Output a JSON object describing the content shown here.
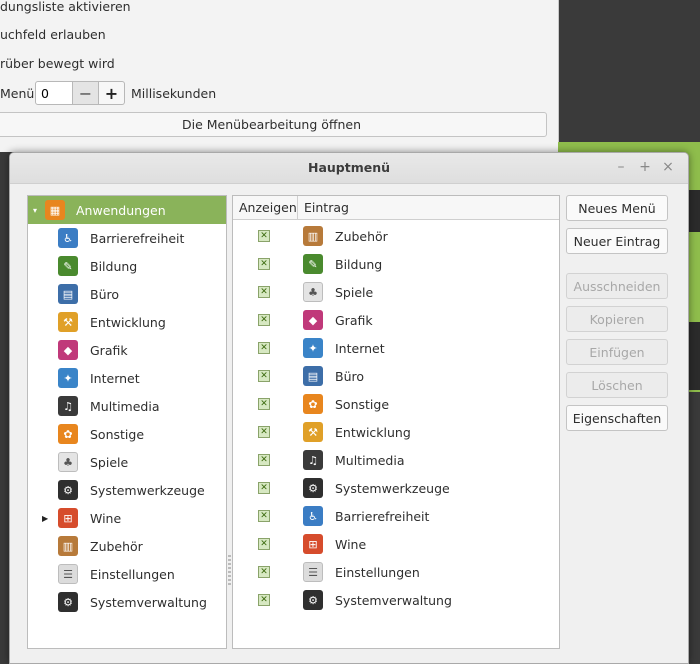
{
  "background_window": {
    "lines": [
      "dungsliste aktivieren",
      "uchfeld erlauben",
      "rüber bewegt wird"
    ],
    "delay_label": "Menü:",
    "delay_value": "0",
    "delay_unit": "Millisekunden",
    "minus": "−",
    "plus": "+",
    "open_editor": "Die Menübearbeitung öffnen"
  },
  "dialog": {
    "title": "Hauptmenü",
    "wm_minimize": "–",
    "wm_maximize": "+",
    "wm_close": "×"
  },
  "tree": {
    "root": {
      "label": "Anwendungen",
      "icon": "applications-icon",
      "expanded": true,
      "selected": true
    },
    "items": [
      {
        "label": "Barrierefreiheit",
        "icon": "accessibility-icon",
        "color": "#3b7dc4"
      },
      {
        "label": "Bildung",
        "icon": "education-icon",
        "color": "#4a8a2e"
      },
      {
        "label": "Büro",
        "icon": "office-icon",
        "color": "#3d6ea8"
      },
      {
        "label": "Entwicklung",
        "icon": "development-icon",
        "color": "#e0a028"
      },
      {
        "label": "Grafik",
        "icon": "graphics-icon",
        "color": "#c0397a"
      },
      {
        "label": "Internet",
        "icon": "internet-icon",
        "color": "#3a84c8"
      },
      {
        "label": "Multimedia",
        "icon": "multimedia-icon",
        "color": "#3a3a3a"
      },
      {
        "label": "Sonstige",
        "icon": "other-icon",
        "color": "#e8861e"
      },
      {
        "label": "Spiele",
        "icon": "games-icon",
        "color": "#e4e4e4"
      },
      {
        "label": "Systemwerkzeuge",
        "icon": "system-tools-icon",
        "color": "#2f2f2f"
      },
      {
        "label": "Wine",
        "icon": "wine-icon",
        "color": "#d64c2c",
        "collapsed_arrow": true
      },
      {
        "label": "Zubehör",
        "icon": "accessories-icon",
        "color": "#b77a3a"
      },
      {
        "label": "Einstellungen",
        "icon": "settings-icon",
        "color": "#dcdcdc"
      },
      {
        "label": "Systemverwaltung",
        "icon": "administration-icon",
        "color": "#2f2f2f"
      }
    ]
  },
  "list": {
    "col_show": "Anzeigen",
    "col_entry": "Eintrag",
    "rows": [
      {
        "label": "Zubehör",
        "icon": "accessories-icon",
        "color": "#b77a3a"
      },
      {
        "label": "Bildung",
        "icon": "education-icon",
        "color": "#4a8a2e"
      },
      {
        "label": "Spiele",
        "icon": "games-icon",
        "color": "#e4e4e4"
      },
      {
        "label": "Grafik",
        "icon": "graphics-icon",
        "color": "#c0397a"
      },
      {
        "label": "Internet",
        "icon": "internet-icon",
        "color": "#3a84c8"
      },
      {
        "label": "Büro",
        "icon": "office-icon",
        "color": "#3d6ea8"
      },
      {
        "label": "Sonstige",
        "icon": "other-icon",
        "color": "#e8861e"
      },
      {
        "label": "Entwicklung",
        "icon": "development-icon",
        "color": "#e0a028"
      },
      {
        "label": "Multimedia",
        "icon": "multimedia-icon",
        "color": "#3a3a3a"
      },
      {
        "label": "Systemwerkzeuge",
        "icon": "system-tools-icon",
        "color": "#2f2f2f"
      },
      {
        "label": "Barrierefreiheit",
        "icon": "accessibility-icon",
        "color": "#3b7dc4"
      },
      {
        "label": "Wine",
        "icon": "wine-icon",
        "color": "#d64c2c"
      },
      {
        "label": "Einstellungen",
        "icon": "settings-icon",
        "color": "#dcdcdc"
      },
      {
        "label": "Systemverwaltung",
        "icon": "administration-icon",
        "color": "#2f2f2f"
      }
    ]
  },
  "buttons": {
    "new_menu": "Neues Menü",
    "new_entry": "Neuer Eintrag",
    "cut": "Ausschneiden",
    "copy": "Kopieren",
    "paste": "Einfügen",
    "delete": "Löschen",
    "properties": "Eigenschaften"
  },
  "colors": {
    "accent_green": "#8ab35a",
    "check_green": "#d7e8c2"
  }
}
